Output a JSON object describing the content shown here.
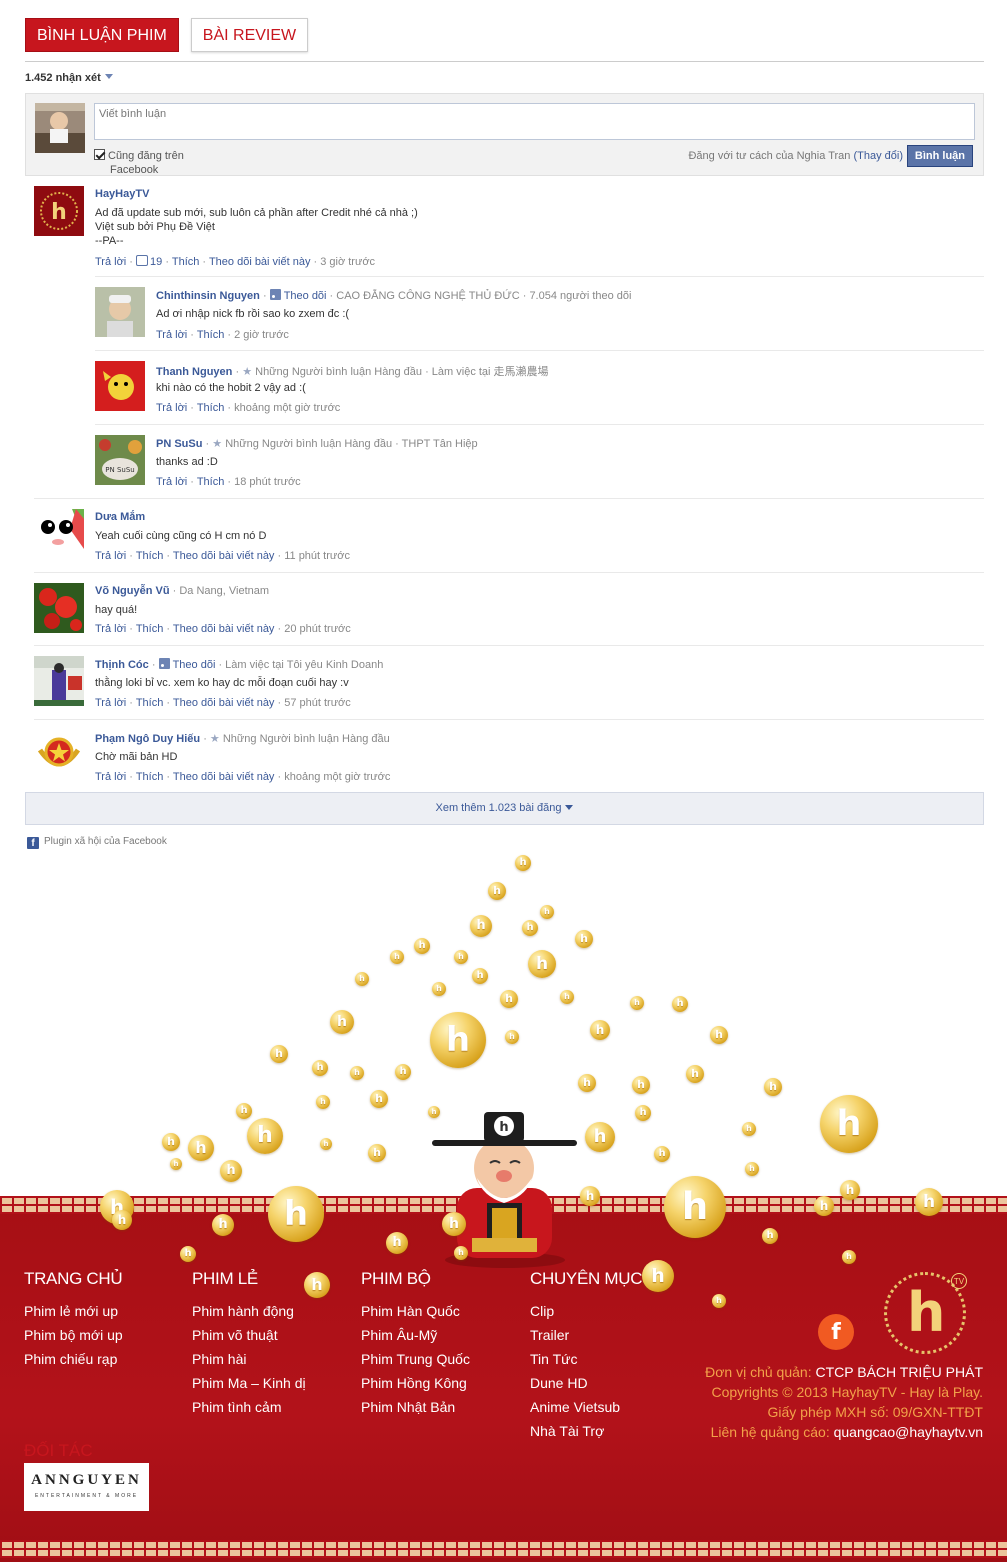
{
  "tabs": [
    {
      "label": "BÌNH LUẬN PHIM",
      "active": true
    },
    {
      "label": "BÀI REVIEW",
      "active": false
    }
  ],
  "comment_count": "1.452 nhận xét",
  "composer": {
    "placeholder": "Viết bình luận",
    "share_line1": "Cũng đăng trên",
    "share_line2": "Facebook",
    "posting_as": "Đăng với tư cách của Nghia Tran",
    "change": "(Thay đổi)",
    "post_button": "Bình luận"
  },
  "comments": [
    {
      "name": "HayHayTV",
      "meta": "",
      "body": "Ad đã update sub mới, sub luôn cả phần after Credit nhé cả nhà ;)\nViệt sub bởi Phụ Đề Việt\n--PA--",
      "reply": "Trả lời",
      "likes": "19",
      "like": "Thích",
      "follow": "Theo dõi bài viết này",
      "time": "3 giờ trước"
    },
    {
      "name": "Chinthinsin Nguyen",
      "meta_follow": "Theo dõi",
      "meta": "CAO ĐẲNG CÔNG NGHỆ THỦ ĐỨC",
      "meta2": "7.054 người theo dõi",
      "body": "Ad ơi nhập nick fb rồi sao ko zxem đc :(",
      "reply": "Trả lời",
      "like": "Thích",
      "time": "2 giờ trước"
    },
    {
      "name": "Thanh Nguyen",
      "meta": "Những Người bình luận Hàng đầu",
      "meta2": "Làm việc tại 走馬瀨農場",
      "body": "khi nào có the hobit 2 vậy ad :(",
      "reply": "Trả lời",
      "like": "Thích",
      "time": "khoảng một giờ trước"
    },
    {
      "name": "PN SuSu",
      "meta": "Những Người bình luận Hàng đầu",
      "meta2": "THPT Tân Hiệp",
      "body": "thanks ad :D",
      "reply": "Trả lời",
      "like": "Thích",
      "time": "18 phút trước"
    },
    {
      "name": "Dưa Mắm",
      "meta": "",
      "body": "Yeah cuối cùng cũng có H cm nó D",
      "reply": "Trả lời",
      "like": "Thích",
      "follow": "Theo dõi bài viết này",
      "time": "11 phút trước"
    },
    {
      "name": "Võ Nguyễn Vũ",
      "meta": "Da Nang, Vietnam",
      "body": "hay quá!",
      "reply": "Trả lời",
      "like": "Thích",
      "follow": "Theo dõi bài viết này",
      "time": "20 phút trước"
    },
    {
      "name": "Thịnh Cóc",
      "meta_follow": "Theo dõi",
      "meta": "Làm việc tại Tôi yêu Kinh Doanh",
      "body": "thằng loki bỉ vc. xem ko hay dc mỗi đoạn cuối hay :v",
      "reply": "Trả lời",
      "like": "Thích",
      "follow": "Theo dõi bài viết này",
      "time": "57 phút trước"
    },
    {
      "name": "Phạm Ngô Duy Hiếu",
      "meta": "Những Người bình luận Hàng đầu",
      "body": "Chờ mãi bản HD",
      "reply": "Trả lời",
      "like": "Thích",
      "follow": "Theo dõi bài viết này",
      "time": "khoảng một giờ trước"
    }
  ],
  "see_more": "Xem thêm 1.023 bài đăng",
  "plugin": "Plugin xã hội của Facebook",
  "footer": {
    "columns": [
      {
        "title": "TRANG CHỦ",
        "links": [
          "Phim lẻ mới up",
          "Phim bộ mới up",
          "Phim chiếu rạp"
        ]
      },
      {
        "title": "PHIM LẺ",
        "links": [
          "Phim hành động",
          "Phim võ thuật",
          "Phim hài",
          "Phim Ma – Kinh dị",
          "Phim tình cảm"
        ]
      },
      {
        "title": "PHIM BỘ",
        "links": [
          "Phim Hàn Quốc",
          "Phim Âu-Mỹ",
          "Phim Trung Quốc",
          "Phim Hồng Kông",
          "Phim Nhật Bản"
        ]
      },
      {
        "title": "CHUYÊN MỤC",
        "links": [
          "Clip",
          "Trailer",
          "Tin Tức",
          "Dune HD",
          "Anime Vietsub",
          "Nhà Tài Trợ"
        ]
      }
    ],
    "partner_title": "ĐỐI TÁC",
    "partner_name": "ANNGUYEN",
    "partner_sub": "ENTERTAINMENT & MORE",
    "info": {
      "owner_label": "Đơn vị chủ quản:",
      "owner": "CTCP BÁCH TRIỆU PHÁT",
      "copyright": "Copyrights © 2013 HayhayTV - Hay là Play.",
      "license": "Giấy phép MXH số: 09/GXN-TTĐT",
      "ads_label": "Liên hệ quảng cáo:",
      "ads": "quangcao@hayhaytv.vn"
    },
    "facebook_icon": "f",
    "logo_letter": "h",
    "logo_tv": "TV"
  },
  "colors": {
    "brand_red": "#c7161e",
    "link_blue": "#3b5998",
    "footer_red": "#b3121a",
    "gold": "#f3d27a"
  }
}
